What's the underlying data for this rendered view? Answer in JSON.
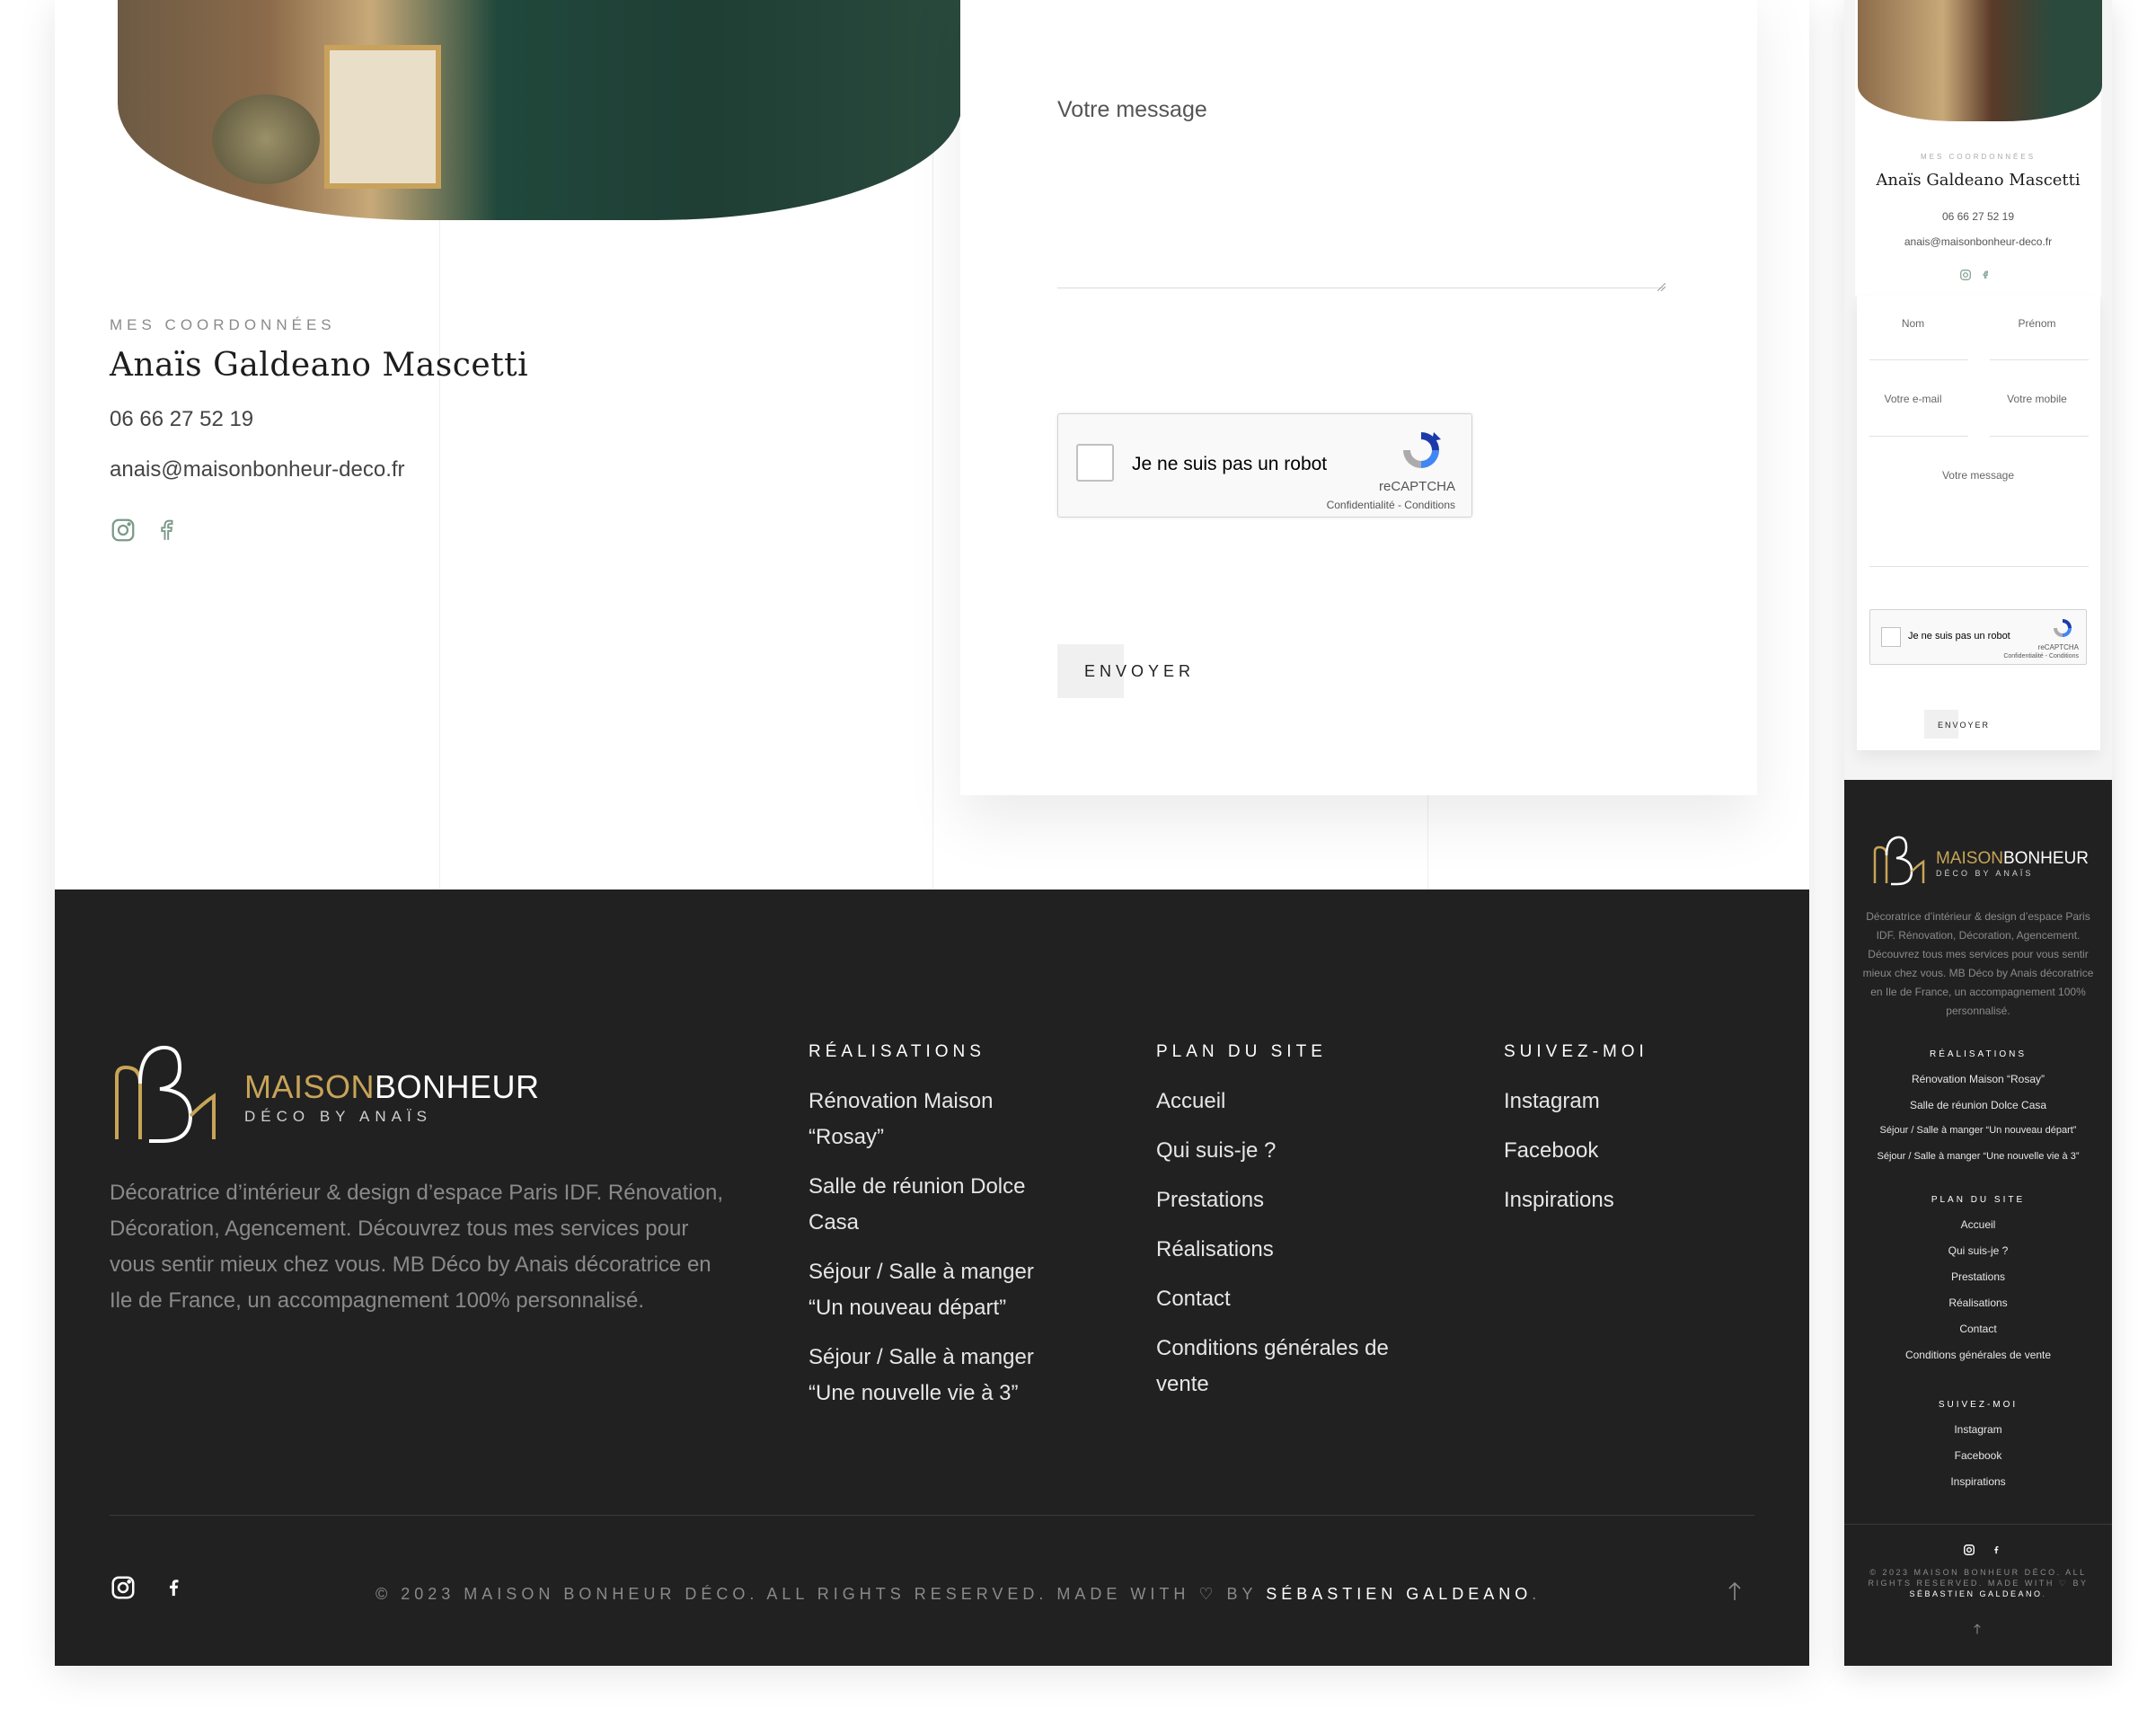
{
  "contact": {
    "eyebrow": "MES COORDONNÉES",
    "name": "Anaïs Galdeano Mascetti",
    "phone": "06 66 27 52 19",
    "email": "anais@maisonbonheur-deco.fr",
    "socials": [
      "instagram-icon",
      "facebook-icon"
    ]
  },
  "form": {
    "message_placeholder": "Votre message",
    "captcha_label": "Je ne suis pas un robot",
    "captcha_brand": "reCAPTCHA",
    "captcha_terms": "Confidentialité - Conditions",
    "submit_label": "ENVOYER"
  },
  "mobile_form": {
    "nom": "Nom",
    "prenom": "Prénom",
    "email": "Votre e-mail",
    "mobile": "Votre mobile",
    "message": "Votre message"
  },
  "footer": {
    "logo_maison": "MAISON",
    "logo_bonheur": "BONHEUR",
    "logo_tagline": "DÉCO BY ANAÏS",
    "description": "Décoratrice d’intérieur & design d’espace Paris IDF. Rénovation, Décoration, Agencement. Découvrez tous mes services pour vous sentir mieux chez vous. MB Déco by Anais décoratrice en Ile de France, un accompagnement 100% personnalisé.",
    "realisations": {
      "heading": "RÉALISATIONS",
      "items": [
        "Rénovation Maison “Rosay”",
        "Salle de réunion Dolce Casa",
        "Séjour / Salle à manger “Un nouveau départ”",
        "Séjour / Salle à manger “Une nouvelle vie à 3”"
      ]
    },
    "plan": {
      "heading": "PLAN DU SITE",
      "items": [
        "Accueil",
        "Qui suis-je ?",
        "Prestations",
        "Réalisations",
        "Contact",
        "Conditions générales de vente"
      ]
    },
    "suivez": {
      "heading": "SUIVEZ-MOI",
      "items": [
        "Instagram",
        "Facebook",
        "Inspirations"
      ]
    },
    "copyright_prefix": "© 2023 MAISON BONHEUR DÉCO. ALL RIGHTS RESERVED. MADE WITH ♡ BY ",
    "copyright_author": "SÉBASTIEN GALDEANO",
    "copyright_suffix": ".",
    "mobile_copyright_prefix": "© 2023 MAISON BONHEUR DÉCO. ALL RIGHTS RESERVED. MADE WITH ♡ BY",
    "mobile_realisations": [
      "Rénovation Maison “Rosay”",
      "Salle de réunion Dolce Casa",
      "Séjour / Salle à manger “Un nouveau départ”",
      "Séjour / Salle à manger “Une nouvelle vie à 3”"
    ]
  },
  "colors": {
    "gold": "#c8a458",
    "footer_bg": "#212121",
    "icon_green": "#7a9a88"
  }
}
